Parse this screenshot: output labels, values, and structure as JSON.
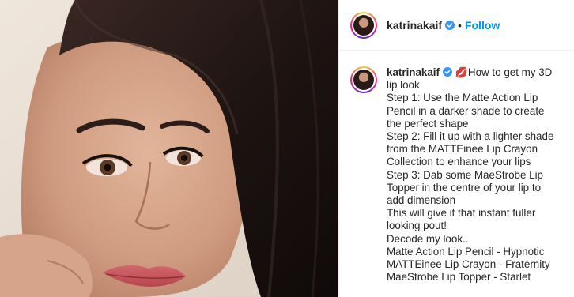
{
  "post": {
    "username": "katrinakaif",
    "separator": "•",
    "follow_label": "Follow",
    "photo_alt": "Close-up portrait with dark hair and pink lips"
  },
  "caption": {
    "username": "katrinakaif",
    "emoji": "💋",
    "first_line_rest": "How to get my 3D",
    "lines": [
      "lip look",
      "Step 1: Use the Matte Action Lip",
      "Pencil in a darker shade to create",
      "the perfect shape",
      "Step 2: Fill it up with a lighter shade",
      "from the MATTEinee Lip Crayon",
      "Collection to enhance your lips",
      "Step 3: Dab some MaeStrobe Lip",
      "Topper in the centre of your lip to",
      "add dimension",
      "This will give it that instant fuller",
      "looking pout!",
      "Decode my look..",
      "Matte Action Lip Pencil - Hypnotic",
      "MATTEinee Lip Crayon - Fraternity",
      "MaeStrobe Lip Topper - Starlet"
    ]
  },
  "icons": {
    "verified": "verified-badge-icon",
    "avatar": "profile-avatar"
  },
  "colors": {
    "link": "#0095f6",
    "text": "#262626",
    "verified": "#3897f0",
    "border": "#efefef"
  }
}
